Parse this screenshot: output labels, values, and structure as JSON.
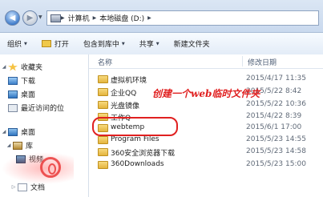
{
  "address": {
    "breadcrumbs": [
      "计算机",
      "本地磁盘 (D:)"
    ]
  },
  "toolbar": {
    "items": [
      {
        "label": "组织",
        "dropdown": true
      },
      {
        "label": "打开",
        "dropdown": false
      },
      {
        "label": "包含到库中",
        "dropdown": true
      },
      {
        "label": "共享",
        "dropdown": true
      },
      {
        "label": "新建文件夹",
        "dropdown": false
      }
    ]
  },
  "nav": {
    "items": [
      {
        "label": "收藏夹",
        "icon": "star-icon"
      },
      {
        "label": "下载",
        "icon": "download-folder-icon"
      },
      {
        "label": "桌面",
        "icon": "desktop-icon"
      },
      {
        "label": "最近访问的位",
        "icon": "recent-places-icon"
      },
      {
        "label": "桌面",
        "icon": "desktop-icon"
      },
      {
        "label": "库",
        "icon": "library-icon"
      },
      {
        "label": "视频",
        "icon": "video-library-icon"
      },
      {
        "label": "文档",
        "icon": "documents-icon"
      }
    ]
  },
  "files": {
    "columns": {
      "name": "名称",
      "date": "修改日期"
    },
    "rows": [
      {
        "name": "虚拟机环境",
        "date": "2015/4/17 11:35"
      },
      {
        "name": "企业QQ",
        "date": "2015/5/22 8:42"
      },
      {
        "name": "光盘镜像",
        "date": "2015/5/22 10:36"
      },
      {
        "name": "工作Q",
        "date": "2015/4/22 8:39"
      },
      {
        "name": "webtemp",
        "date": "2015/6/1 17:00"
      },
      {
        "name": "Program Files",
        "date": "2015/5/23 14:55"
      },
      {
        "name": "360安全浏览器下载",
        "date": "2015/5/23 14:58"
      },
      {
        "name": "360Downloads",
        "date": "2015/5/23 15:00"
      }
    ]
  },
  "annotation": {
    "text": "创建一个web临时文件夹",
    "color": "#e02020"
  },
  "colors": {
    "toolbar_bg": "#e3ecf7",
    "folder": "#e4b53e",
    "annotation": "#e02020"
  }
}
